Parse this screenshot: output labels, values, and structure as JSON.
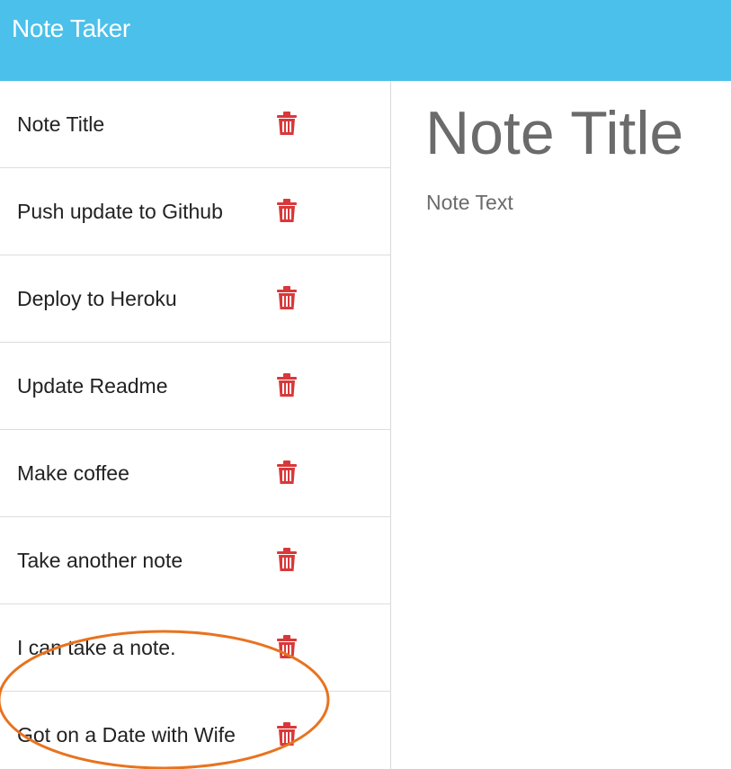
{
  "app": {
    "brand": "Note Taker"
  },
  "notes": [
    {
      "title": "Note Title",
      "icon": "trash-icon"
    },
    {
      "title": "Push update to Github",
      "icon": "trash-icon"
    },
    {
      "title": "Deploy to Heroku",
      "icon": "trash-icon"
    },
    {
      "title": "Update Readme",
      "icon": "trash-icon"
    },
    {
      "title": "Make coffee",
      "icon": "trash-icon"
    },
    {
      "title": "Take another note",
      "icon": "trash-icon"
    },
    {
      "title": "I can take a note.",
      "icon": "trash-icon"
    },
    {
      "title": "Got on a Date with Wife",
      "icon": "trash-icon"
    }
  ],
  "editor": {
    "title_placeholder": "Note Title",
    "text_placeholder": "Note Text"
  },
  "colors": {
    "navbar": "#4bc0ea",
    "delete_icon": "#d9383a",
    "annotation": "#e8731f",
    "placeholder": "#6b6b6b"
  }
}
